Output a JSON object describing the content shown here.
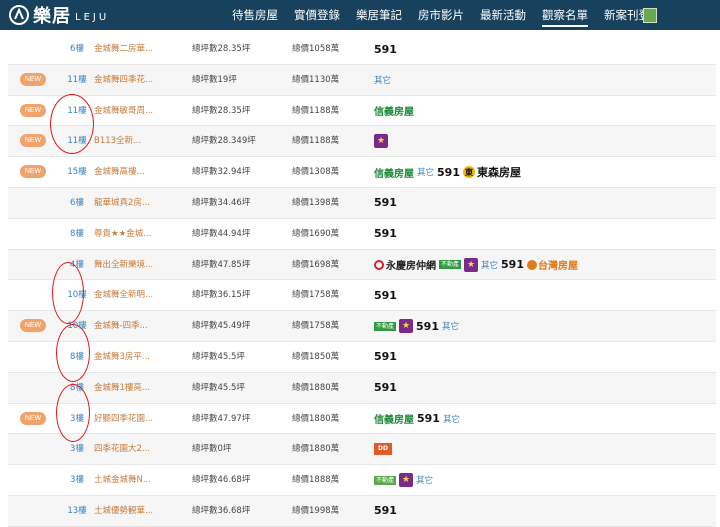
{
  "header": {
    "logo_cn": "樂居",
    "logo_en": "LEJU",
    "nav": [
      {
        "label": "待售房屋",
        "active": false
      },
      {
        "label": "實價登錄",
        "active": false
      },
      {
        "label": "樂居筆記",
        "active": false
      },
      {
        "label": "房市影片",
        "active": false
      },
      {
        "label": "最新活動",
        "active": false
      },
      {
        "label": "觀察名單",
        "active": true
      },
      {
        "label": "新案刊登",
        "active": false
      }
    ]
  },
  "badge_text": "NEW",
  "other_text": "其它",
  "rows": [
    {
      "new": false,
      "floor": "6樓",
      "name": "金城舞二房華...",
      "area": "總坪數28.35坪",
      "price": "總價1058萬",
      "sources": [
        "591"
      ]
    },
    {
      "new": true,
      "floor": "11樓",
      "name": "金城舞四季花...",
      "area": "總坪數19坪",
      "price": "總價1130萬",
      "sources": [
        "other"
      ]
    },
    {
      "new": true,
      "floor": "11樓",
      "name": "金城舞敏哥周...",
      "area": "總坪數28.35坪",
      "price": "總價1188萬",
      "sources": [
        "xinyi"
      ]
    },
    {
      "new": true,
      "floor": "11樓",
      "name": "B113全新...",
      "area": "總坪數28.349坪",
      "price": "總價1188萬",
      "sources": [
        "star"
      ]
    },
    {
      "new": true,
      "floor": "15樓",
      "name": "金城舞高樓...",
      "area": "總坪數32.94坪",
      "price": "總價1308萬",
      "sources": [
        "xinyi",
        "other",
        "591",
        "dongsen"
      ]
    },
    {
      "new": false,
      "floor": "6樓",
      "name": "龍華城真2房...",
      "area": "總坪數34.46坪",
      "price": "總價1398萬",
      "sources": [
        "591"
      ]
    },
    {
      "new": false,
      "floor": "8樓",
      "name": "尊貴★★金城...",
      "area": "總坪數44.94坪",
      "price": "總價1690萬",
      "sources": [
        "591"
      ]
    },
    {
      "new": false,
      "floor": "4樓",
      "name": "舞出全新樂境...",
      "area": "總坪數47.85坪",
      "price": "總價1698萬",
      "sources": [
        "yongqing",
        "greenbox",
        "star",
        "other",
        "591",
        "taiwan"
      ]
    },
    {
      "new": false,
      "floor": "10樓",
      "name": "金城舞全新明...",
      "area": "總坪數36.15坪",
      "price": "總價1758萬",
      "sources": [
        "591"
      ]
    },
    {
      "new": true,
      "floor": "10樓",
      "name": "金城舞-四季...",
      "area": "總坪數45.49坪",
      "price": "總價1758萬",
      "sources": [
        "greenbox",
        "star",
        "591",
        "other"
      ]
    },
    {
      "new": false,
      "floor": "8樓",
      "name": "金城舞3房平...",
      "area": "總坪數45.5坪",
      "price": "總價1850萬",
      "sources": [
        "591"
      ]
    },
    {
      "new": false,
      "floor": "8樓",
      "name": "金城舞1樓亮...",
      "area": "總坪數45.5坪",
      "price": "總價1880萬",
      "sources": [
        "591"
      ]
    },
    {
      "new": true,
      "floor": "3樓",
      "name": "好聽四季花園...",
      "area": "總坪數47.97坪",
      "price": "總價1880萬",
      "sources": [
        "xinyi",
        "591",
        "other"
      ]
    },
    {
      "new": false,
      "floor": "3樓",
      "name": "四季花園大2...",
      "area": "總坪數0坪",
      "price": "總價1880萬",
      "sources": [
        "diamond"
      ]
    },
    {
      "new": false,
      "floor": "3樓",
      "name": "土城金城舞N...",
      "area": "總坪數46.68坪",
      "price": "總價1888萬",
      "sources": [
        "greenbox2",
        "star",
        "other"
      ]
    },
    {
      "new": false,
      "floor": "13樓",
      "name": "土城優勢観華...",
      "area": "總坪數36.68坪",
      "price": "總價1998萬",
      "sources": [
        "591"
      ]
    }
  ],
  "source_labels": {
    "591": "591",
    "xinyi": "信義房屋",
    "greenbox": "不動產",
    "greenbox2": "不動產",
    "star": "★",
    "dongsen": "東森房屋",
    "dongsen_mark": "東",
    "yongqing": "永慶房仲網",
    "taiwan": "台灣房屋",
    "diamond": "DD"
  }
}
